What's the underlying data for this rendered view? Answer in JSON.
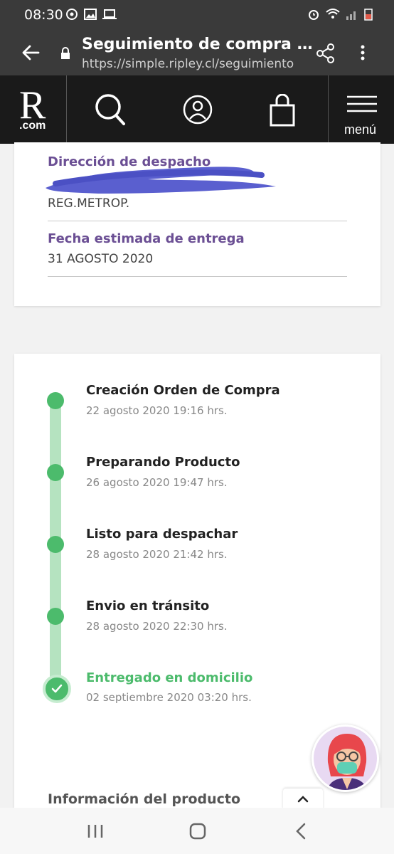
{
  "status_bar": {
    "time": "08:30"
  },
  "browser": {
    "title": "Seguimiento de compra para o...",
    "url": "https://simple.ripley.cl/seguimiento"
  },
  "site_nav": {
    "logo_letter": "R",
    "logo_suffix": ".com",
    "menu_label": "menú"
  },
  "shipping": {
    "address_label": "Dirección de despacho",
    "address_region": "REG.METROP.",
    "delivery_label": "Fecha estimada de entrega",
    "delivery_date": "31 AGOSTO 2020"
  },
  "tracking": {
    "steps": [
      {
        "title": "Creación Orden de Compra",
        "date": "22 agosto 2020 19:16 hrs."
      },
      {
        "title": "Preparando Producto",
        "date": "26 agosto 2020 19:47 hrs."
      },
      {
        "title": "Listo para despachar",
        "date": "28 agosto 2020 21:42 hrs."
      },
      {
        "title": "Envio en tránsito",
        "date": "28 agosto 2020 22:30 hrs."
      },
      {
        "title": "Entregado en domicilio",
        "date": "02 septiembre 2020 03:20 hrs."
      }
    ]
  },
  "product_section": {
    "title": "Información del producto"
  },
  "colors": {
    "accent_purple": "#6b4f94",
    "success_green": "#4cbb6c",
    "nav_dark": "#1a1a1a",
    "redaction_blue": "#5a5fcf"
  }
}
